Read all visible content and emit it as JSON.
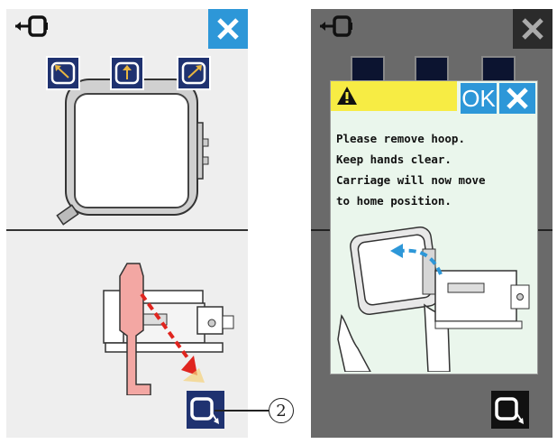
{
  "left_screen": {
    "close_icon": "close-icon",
    "top_icon": "hoop-attach-icon",
    "hoop_buttons": [
      "hoop-move-top-left-icon",
      "hoop-move-up-icon",
      "hoop-move-top-right-icon"
    ],
    "home_button_icon": "carriage-home-icon",
    "callout_number": "2"
  },
  "right_screen": {
    "close_icon": "close-icon",
    "home_button_icon": "carriage-home-icon",
    "dialog": {
      "warning_icon": "warning-icon",
      "ok_label": "OK",
      "close_icon": "close-icon",
      "message_lines": [
        "Please remove hoop.",
        "Keep hands clear.",
        "Carriage will now move",
        "to home position."
      ]
    }
  },
  "colors": {
    "accent_blue": "#2d97d8",
    "button_navy": "#1f3270",
    "warning_yellow": "#f7ec44",
    "dialog_bg": "#eaf6ec"
  }
}
